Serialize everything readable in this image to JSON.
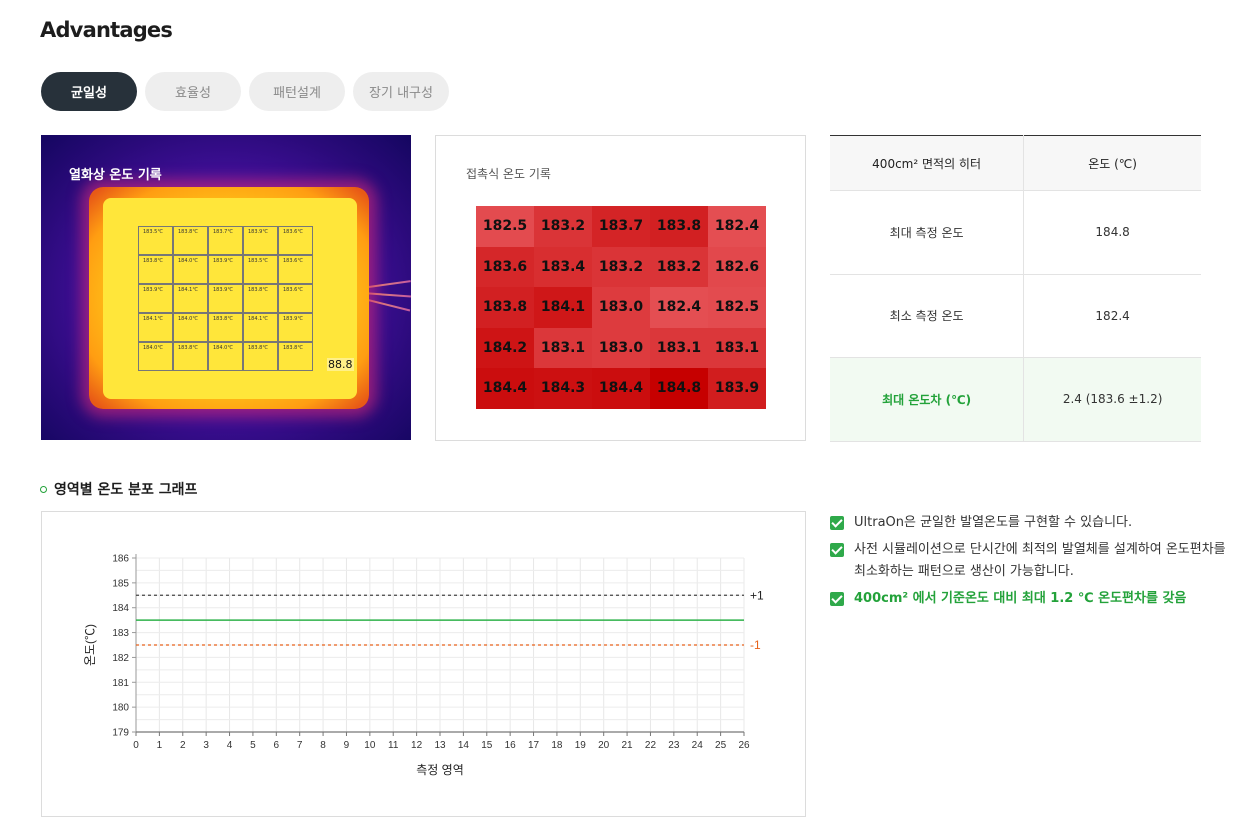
{
  "page": {
    "title": "Advantages"
  },
  "tabs": [
    "균일성",
    "효율성",
    "패턴설계",
    "장기 내구성"
  ],
  "thermal": {
    "label": "열화상 온도 기록",
    "readout": "88.8",
    "cell_values": [
      [
        "183.5℃",
        "183.8℃",
        "183.7℃",
        "183.9℃",
        "183.6℃"
      ],
      [
        "183.8℃",
        "184.0℃",
        "183.9℃",
        "183.5℃",
        "183.6℃"
      ],
      [
        "183.9℃",
        "184.1℃",
        "183.9℃",
        "183.8℃",
        "183.6℃"
      ],
      [
        "184.1℃",
        "184.0℃",
        "183.8℃",
        "184.1℃",
        "183.9℃"
      ],
      [
        "184.0℃",
        "183.8℃",
        "184.0℃",
        "183.8℃",
        "183.8℃"
      ]
    ]
  },
  "contact": {
    "label": "접촉식 온도 기록",
    "grid": [
      [
        "182.5",
        "183.2",
        "183.7",
        "183.8",
        "182.4"
      ],
      [
        "183.6",
        "183.4",
        "183.2",
        "183.2",
        "182.6"
      ],
      [
        "183.8",
        "184.1",
        "183.0",
        "182.4",
        "182.5"
      ],
      [
        "184.2",
        "183.1",
        "183.0",
        "183.1",
        "183.1"
      ],
      [
        "184.4",
        "184.3",
        "184.4",
        "184.8",
        "183.9"
      ]
    ]
  },
  "spec_table": {
    "headers": [
      "400cm² 면적의 히터",
      "온도 (℃)"
    ],
    "rows": [
      [
        "최대 측정 온도",
        "184.8"
      ],
      [
        "최소 측정 온도",
        "182.4"
      ],
      [
        "최대 온도차 (℃)",
        "2.4 (183.6 ±1.2)"
      ]
    ]
  },
  "graph_section": {
    "title": "영역별 온도 분포 그래프"
  },
  "chart_data": {
    "type": "line",
    "title": "",
    "xlabel": "측정 영역",
    "ylabel": "온도(℃)",
    "xlim": [
      0,
      26
    ],
    "ylim": [
      179,
      186
    ],
    "x_ticks": [
      0,
      1,
      2,
      3,
      4,
      5,
      6,
      7,
      8,
      9,
      10,
      11,
      12,
      13,
      14,
      15,
      16,
      17,
      18,
      19,
      20,
      21,
      22,
      23,
      24,
      25,
      26
    ],
    "y_ticks": [
      179,
      180,
      181,
      182,
      183,
      184,
      185,
      186
    ],
    "grid": true,
    "series": [
      {
        "name": "+1",
        "style": "dashed",
        "color": "#444444",
        "x": [
          0,
          26
        ],
        "y": [
          184.5,
          184.5
        ]
      },
      {
        "style": "solid",
        "color": "#2fb24a",
        "x": [
          0,
          26
        ],
        "y": [
          183.5,
          183.5
        ]
      },
      {
        "name": "-1",
        "style": "dashed",
        "color": "#e8621a",
        "x": [
          0,
          26
        ],
        "y": [
          182.5,
          182.5
        ]
      }
    ]
  },
  "bullets": [
    "UltraOn은 균일한 발열온도를 구현할 수 있습니다.",
    "사전 시뮬레이션으로 단시간에 최적의 발열체를 설계하여 온도편차를 최소화하는 패턴으로 생산이 가능합니다.",
    "400cm² 에서 기준온도 대비 최대 1.2 ℃ 온도편차를 갖음"
  ],
  "colors": {
    "accent": "#2fb24a",
    "tab_active": "#27313a",
    "minus_line": "#e8621a"
  }
}
